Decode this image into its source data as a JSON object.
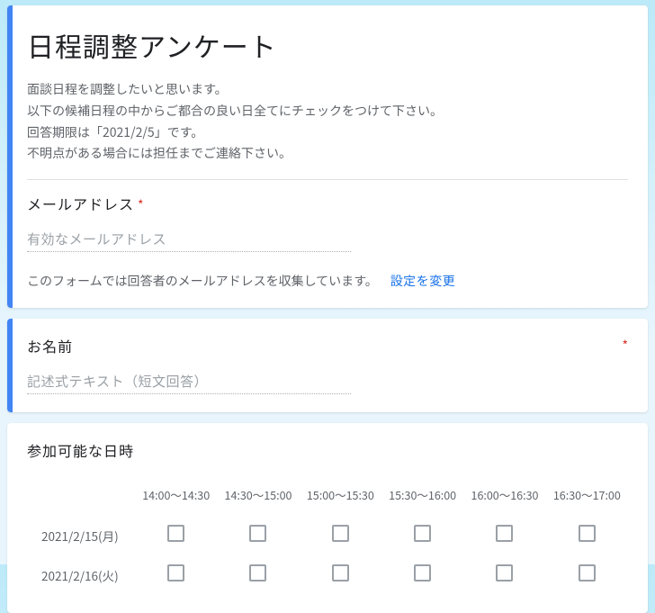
{
  "form": {
    "title": "日程調整アンケート",
    "description": "面談日程を調整したいと思います。\n以下の候補日程の中からご都合の良い日全てにチェックをつけて下さい。\n回答期限は「2021/2/5」です。\n不明点がある場合には担任までご連絡下さい。"
  },
  "email": {
    "label": "メールアドレス",
    "required_mark": "*",
    "placeholder": "有効なメールアドレス",
    "collection_notice": "このフォームでは回答者のメールアドレスを収集しています。",
    "change_settings": "設定を変更"
  },
  "name_question": {
    "label": "お名前",
    "required_mark": "*",
    "placeholder": "記述式テキスト（短文回答）"
  },
  "availability": {
    "label": "参加可能な日時",
    "time_slots": [
      "14:00～14:30",
      "14:30～15:00",
      "15:00～15:30",
      "15:30～16:00",
      "16:00～16:30",
      "16:30～17:00"
    ],
    "dates": [
      "2021/2/15(月)",
      "2021/2/16(火)"
    ]
  }
}
